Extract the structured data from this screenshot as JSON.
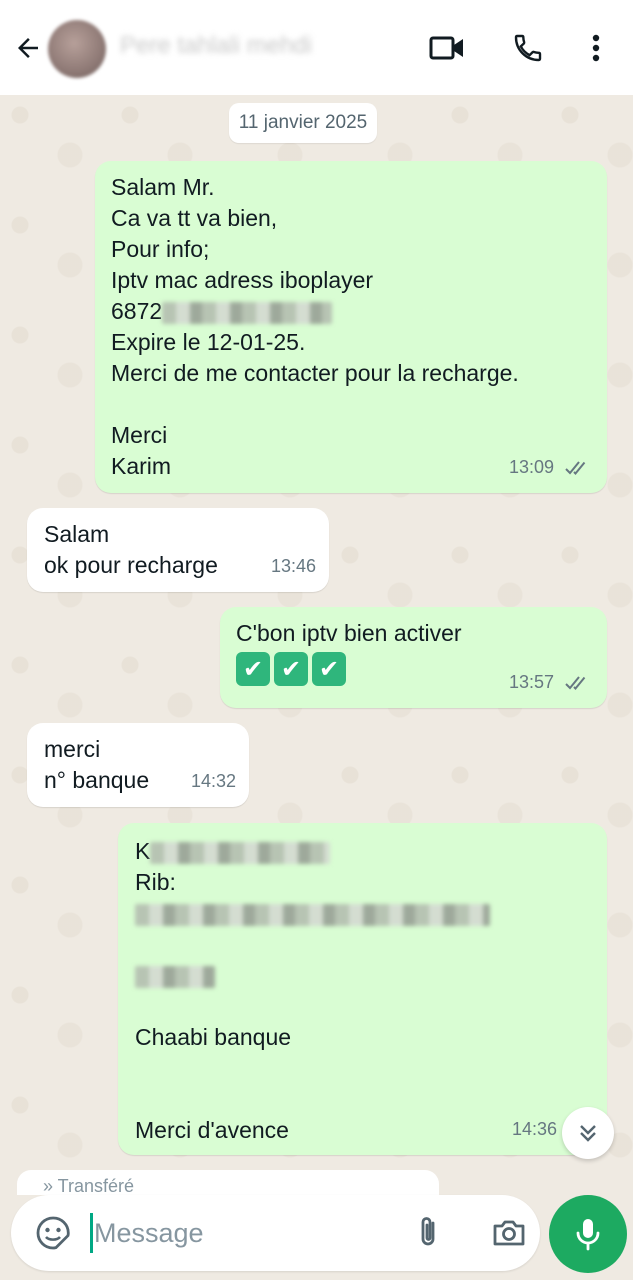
{
  "header": {
    "contact_name": "Pere tahlali mehdi",
    "icons": [
      "back-arrow-icon",
      "video-call-icon",
      "phone-icon",
      "more-vert-icon"
    ]
  },
  "chat": {
    "date_chip": "11 janvier 2025",
    "messages": [
      {
        "direction": "outgoing",
        "lines": [
          "Salam Mr.",
          "Ca va tt va bien,",
          "Pour info;",
          "Iptv mac adress iboplayer",
          "6872",
          "Expire le 12-01-25.",
          "Merci de me contacter pour la recharge.",
          "",
          "Merci",
          "Karim"
        ],
        "time": "13:09",
        "status": "read"
      },
      {
        "direction": "incoming",
        "lines": [
          "Salam",
          "ok pour recharge"
        ],
        "time": "13:46"
      },
      {
        "direction": "outgoing",
        "lines": [
          "C'bon iptv bien activer"
        ],
        "emoji": [
          "✔",
          "✔",
          "✔"
        ],
        "time": "13:57",
        "status": "read"
      },
      {
        "direction": "incoming",
        "lines": [
          "merci",
          "n° banque"
        ],
        "time": "14:32"
      },
      {
        "direction": "outgoing",
        "lines": [
          "K",
          "Rib:",
          "",
          "",
          "",
          "Chaabi banque",
          "",
          "",
          "Merci d'avence"
        ],
        "time": "14:36"
      }
    ],
    "partial_message": "» Transféré"
  },
  "input": {
    "placeholder": "Message"
  },
  "colors": {
    "outgoing_bubble": "#d9fdd3",
    "incoming_bubble": "#ffffff",
    "chat_background": "#efeae2",
    "accent": "#1daa61",
    "read_ticks": "#667781"
  }
}
